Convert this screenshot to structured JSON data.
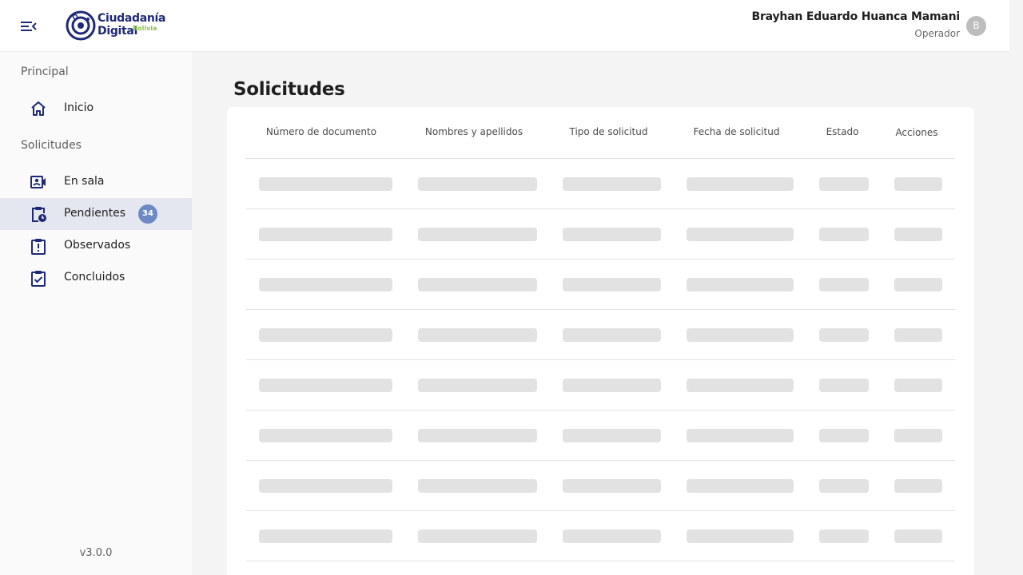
{
  "header": {
    "logo": {
      "line1": "Ciudadanía",
      "line2": "Digital",
      "line3": "Bolivia"
    },
    "user_name": "Brayhan Eduardo Huanca Mamani",
    "user_role": "Operador",
    "avatar_initial": "B"
  },
  "sidebar": {
    "section_principal": "Principal",
    "inicio_label": "Inicio",
    "section_solicitudes": "Solicitudes",
    "items": [
      {
        "label": "En sala",
        "icon": "video-contact-icon"
      },
      {
        "label": "Pendientes",
        "icon": "clipboard-clock-icon",
        "badge": "34",
        "active": true
      },
      {
        "label": "Observados",
        "icon": "clipboard-alert-icon"
      },
      {
        "label": "Concluidos",
        "icon": "clipboard-check-icon"
      }
    ],
    "version": "v3.0.0"
  },
  "main": {
    "title": "Solicitudes",
    "table": {
      "columns": [
        "Número de documento",
        "Nombres y apellidos",
        "Tipo de solicitud",
        "Fecha de solicitud",
        "Estado",
        "Acciones"
      ],
      "loading_rows": 8
    }
  },
  "colors": {
    "primary": "#1e2a78",
    "accent_green": "#8bc34a",
    "active_bg": "#e4e7f0",
    "badge": "#6e89c3",
    "skeleton": "#e2e2e2"
  }
}
